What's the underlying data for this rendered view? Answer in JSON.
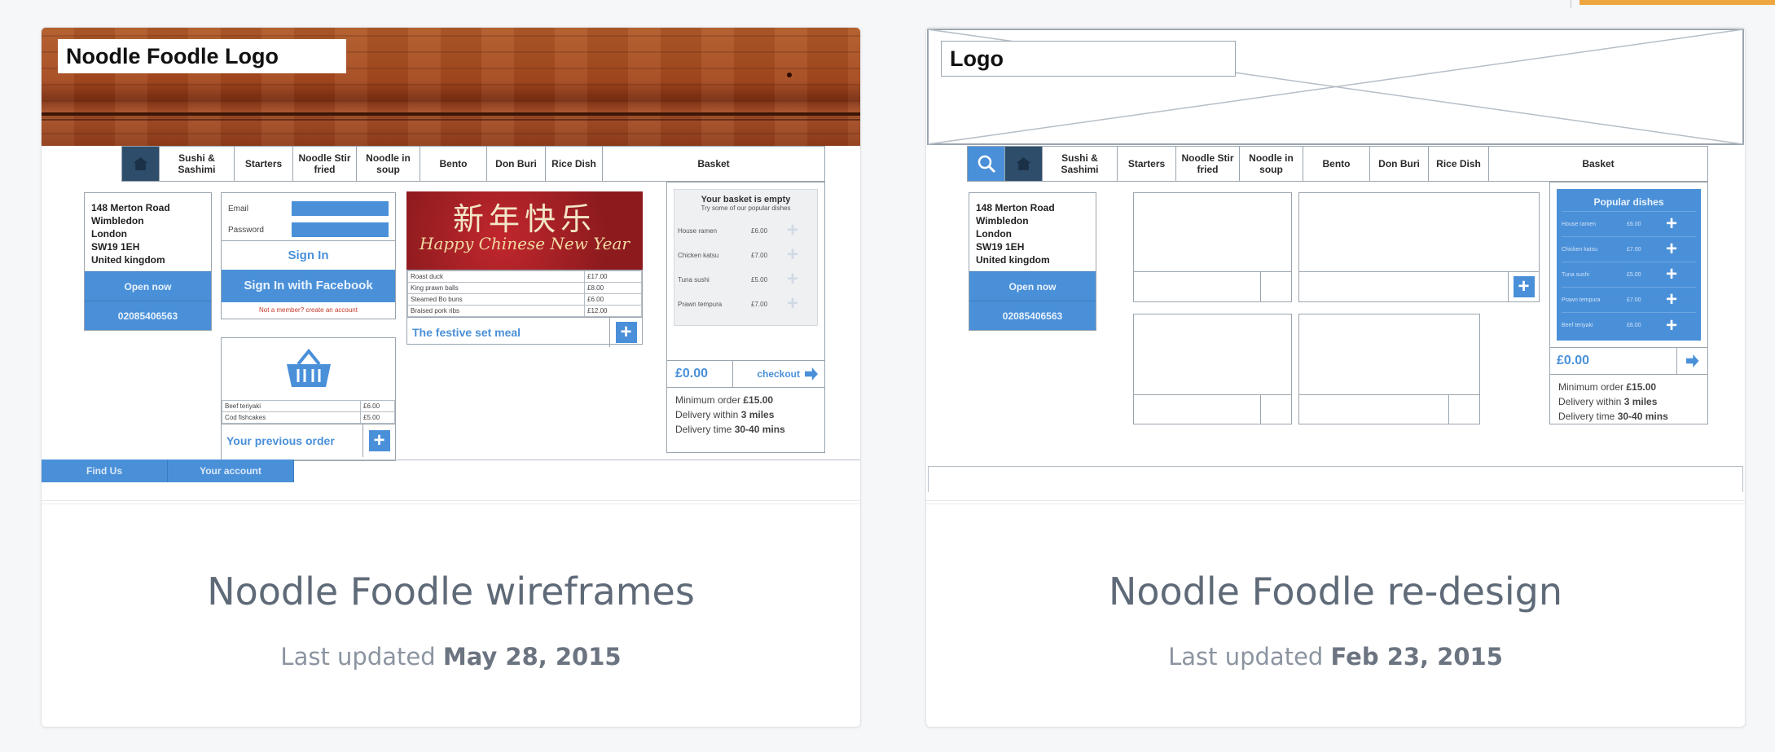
{
  "cards": [
    {
      "title": "Noodle Foodle wireframes",
      "meta_prefix": "Last updated",
      "meta_date": "May 28, 2015",
      "thumb": {
        "logo": "Noodle Foodle Logo",
        "nav": [
          "Sushi & Sashimi",
          "Starters",
          "Noodle Stir fried",
          "Noodle in soup",
          "Bento",
          "Don Buri",
          "Rice Dish",
          "Basket"
        ],
        "address": [
          "148 Merton Road",
          "Wimbledon",
          "London",
          "SW19 1EH",
          "United kingdom"
        ],
        "open_now": "Open now",
        "phone": "02085406563",
        "email_label": "Email",
        "password_label": "Password",
        "sign_in": "Sign In",
        "facebook": "Sign In with Facebook",
        "member": "Not a member? create an account",
        "banner_cn": "新年快乐",
        "banner_en": "Happy Chinese New Year",
        "menu_rows": [
          {
            "name": "Roast duck",
            "price": "£17.00"
          },
          {
            "name": "King prawn balls",
            "price": "£8.00"
          },
          {
            "name": "Steamed Bo buns",
            "price": "£6.00"
          },
          {
            "name": "Braised pork ribs",
            "price": "£12.00"
          }
        ],
        "festive": "The festive set meal",
        "prev_rows": [
          {
            "name": "Beef teriyaki",
            "price": "£6.00"
          },
          {
            "name": "Cod fishcakes",
            "price": "£5.00"
          }
        ],
        "prev_order": "Your previous order",
        "basket_empty": "Your basket is empty",
        "basket_hint": "Try some of our popular dishes",
        "popular": [
          {
            "name": "House ramen",
            "price": "£6.00"
          },
          {
            "name": "Chicken katsu",
            "price": "£7.00"
          },
          {
            "name": "Tuna sushi",
            "price": "£5.00"
          },
          {
            "name": "Prawn tempura",
            "price": "£7.00"
          }
        ],
        "total": "£0.00",
        "checkout": "checkout",
        "min_order_label": "Minimum order",
        "min_order_value": "£15.00",
        "delivery_within_label": "Delivery within",
        "delivery_within_value": "3 miles",
        "delivery_time_label": "Delivery time",
        "delivery_time_value": "30-40 mins",
        "footer": [
          "Find Us",
          "Your account"
        ]
      }
    },
    {
      "title": "Noodle Foodle re-design",
      "meta_prefix": "Last updated",
      "meta_date": "Feb 23, 2015",
      "thumb": {
        "logo": "Logo",
        "nav": [
          "Sushi & Sashimi",
          "Starters",
          "Noodle Stir fried",
          "Noodle in soup",
          "Bento",
          "Don Buri",
          "Rice Dish",
          "Basket"
        ],
        "address": [
          "148 Merton Road",
          "Wimbledon",
          "London",
          "SW19 1EH",
          "United kingdom"
        ],
        "open_now": "Open now",
        "phone": "02085406563",
        "popular_title": "Popular dishes",
        "popular": [
          {
            "name": "House ramen",
            "price": "£6.00"
          },
          {
            "name": "Chicken katsu",
            "price": "£7.00"
          },
          {
            "name": "Tuna sushi",
            "price": "£5.00"
          },
          {
            "name": "Prawn tempura",
            "price": "£7.00"
          },
          {
            "name": "Beef teriyaki",
            "price": "£6.00"
          }
        ],
        "total": "£0.00",
        "min_order_label": "Minimum order",
        "min_order_value": "£15.00",
        "delivery_within_label": "Delivery within",
        "delivery_within_value": "3 miles",
        "delivery_time_label": "Delivery time",
        "delivery_time_value": "30-40 mins"
      }
    }
  ],
  "colors": {
    "accent": "#4a90d9",
    "nav_home": "#2e4d6b",
    "title_text": "#5f6a78",
    "meta_text": "#8b94a0",
    "top_accent": "#f0a640"
  }
}
